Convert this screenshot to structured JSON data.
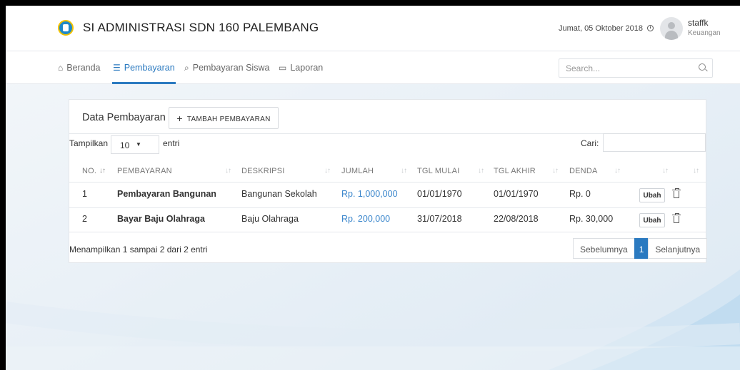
{
  "app": {
    "title": "SI ADMINISTRASI SDN 160 PALEMBANG"
  },
  "header": {
    "date": "Jumat, 05 Oktober 2018",
    "user_name": "staffk",
    "user_role": "Keuangan"
  },
  "nav": {
    "items": [
      {
        "label": "Beranda",
        "icon": "home-icon"
      },
      {
        "label": "Pembayaran",
        "icon": "database-icon",
        "active": true
      },
      {
        "label": "Pembayaran Siswa",
        "icon": "search-icon"
      },
      {
        "label": "Laporan",
        "icon": "calendar-icon"
      }
    ],
    "search_placeholder": "Search..."
  },
  "card": {
    "title": "Data Pembayaran",
    "add_button": "TAMBAH PEMBAYARAN",
    "show_label": "Tampilkan",
    "show_value": "10",
    "show_suffix": "entri",
    "search_label": "Cari:",
    "search_value": ""
  },
  "table": {
    "columns": [
      "NO.",
      "PEMBAYARAN",
      "DESKRIPSI",
      "JUMLAH",
      "TGL MULAI",
      "TGL AKHIR",
      "DENDA"
    ],
    "rows": [
      {
        "no": "1",
        "pembayaran": "Pembayaran Bangunan",
        "deskripsi": "Bangunan Sekolah",
        "jumlah": "Rp. 1,000,000",
        "tgl_mulai": "01/01/1970",
        "tgl_akhir": "01/01/1970",
        "denda": "Rp. 0",
        "action": "Ubah"
      },
      {
        "no": "2",
        "pembayaran": "Bayar Baju Olahraga",
        "deskripsi": "Baju Olahraga",
        "jumlah": "Rp. 200,000",
        "tgl_mulai": "31/07/2018",
        "tgl_akhir": "22/08/2018",
        "denda": "Rp. 30,000",
        "action": "Ubah"
      }
    ]
  },
  "footer": {
    "info": "Menampilkan 1 sampai 2 dari 2 entri",
    "prev": "Sebelumnya",
    "page": "1",
    "next": "Selanjutnya"
  },
  "colors": {
    "accent": "#2b7ac0",
    "link": "#3a86cc",
    "background": "#f2f5f9"
  }
}
